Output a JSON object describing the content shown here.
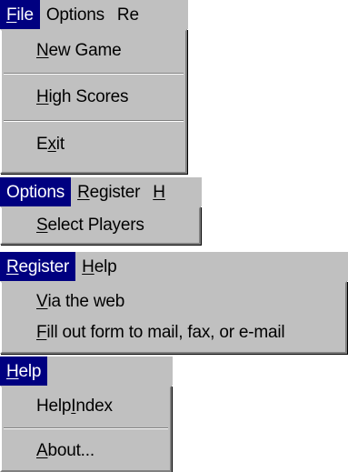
{
  "file_section": {
    "menubar": [
      {
        "pre": "",
        "u": "F",
        "post": "ile",
        "active": true
      },
      {
        "pre": "",
        "u": "",
        "post": "Options",
        "active": false
      },
      {
        "pre": "",
        "u": "",
        "post": "Re",
        "active": false
      }
    ],
    "items": [
      {
        "pre": "",
        "u": "N",
        "post": "ew Game"
      },
      {
        "separator": true
      },
      {
        "pre": "",
        "u": "H",
        "post": "igh Scores"
      },
      {
        "separator": true
      },
      {
        "pre": "E",
        "u": "x",
        "post": "it"
      }
    ]
  },
  "options_section": {
    "menubar": [
      {
        "pre": "",
        "u": "",
        "post": "Options",
        "active": true
      },
      {
        "pre": "",
        "u": "R",
        "post": "egister",
        "active": false
      },
      {
        "pre": "",
        "u": "",
        "post": "H",
        "active": false
      }
    ],
    "items": [
      {
        "pre": "",
        "u": "S",
        "post": "elect Players"
      }
    ]
  },
  "register_section": {
    "menubar": [
      {
        "pre": "",
        "u": "R",
        "post": "egister",
        "active": true
      },
      {
        "pre": "",
        "u": "H",
        "post": "elp",
        "active": false
      }
    ],
    "items": [
      {
        "pre": "",
        "u": "V",
        "post": "ia the web"
      },
      {
        "pre": "",
        "u": "F",
        "post": "ill out form to mail, fax, or e-mail"
      }
    ]
  },
  "help_section": {
    "menubar": [
      {
        "pre": "",
        "u": "H",
        "post": "elp",
        "active": true
      }
    ],
    "items": [
      {
        "pre": "Help ",
        "u": "I",
        "post": "ndex"
      },
      {
        "separator": true
      },
      {
        "pre": "",
        "u": "A",
        "post": "bout..."
      }
    ]
  }
}
